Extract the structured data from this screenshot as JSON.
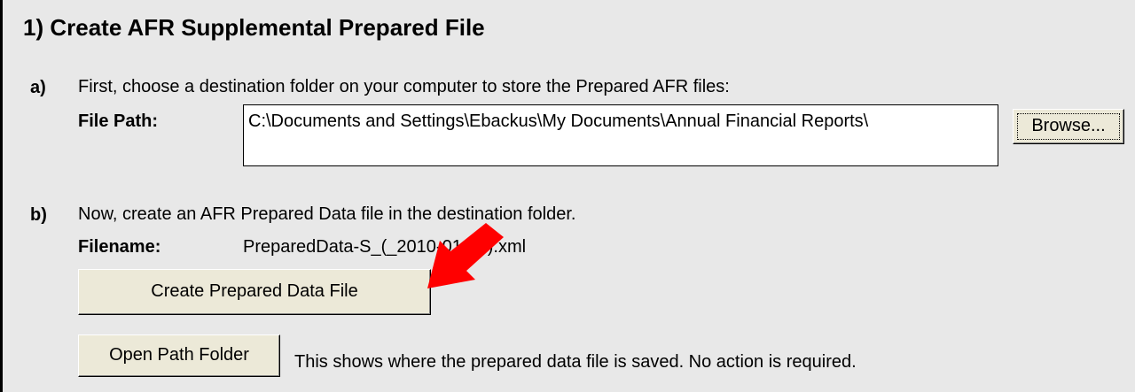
{
  "section": {
    "title": "1) Create AFR Supplemental Prepared File"
  },
  "step_a": {
    "letter": "a)",
    "instruction": "First, choose a destination folder on your computer to store the Prepared AFR files:",
    "file_path_label": "File Path:",
    "file_path_value": "C:\\Documents and Settings\\Ebackus\\My Documents\\Annual Financial Reports\\",
    "browse_label": "Browse..."
  },
  "step_b": {
    "letter": "b)",
    "instruction": "Now, create an AFR Prepared Data file in the destination folder.",
    "filename_label": "Filename:",
    "filename_value": "PreparedData-S_(_2010-01-26).xml",
    "create_button_label": "Create Prepared Data File",
    "open_folder_button_label": "Open Path Folder",
    "open_folder_note": "This shows where the prepared data file is saved.  No action is required."
  },
  "colors": {
    "background": "#e8e8e8",
    "button_face": "#ece9d8",
    "arrow": "#ff0000"
  },
  "icons": {
    "arrow": "red-arrow-icon"
  }
}
